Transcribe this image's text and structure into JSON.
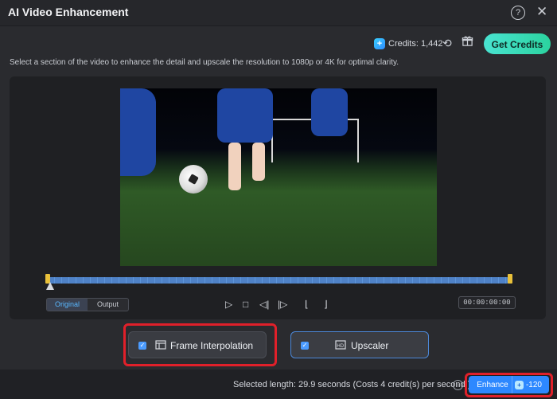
{
  "window": {
    "title": "AI Video Enhancement"
  },
  "toolbar": {
    "credits_label": "Credits: 1,442",
    "get_credits_label": "Get Credits"
  },
  "description": "Select a section of the video to enhance the detail and upscale the resolution to 1080p or 4K for optimal clarity.",
  "preview": {
    "toggle": {
      "original": "Original",
      "output": "Output"
    },
    "timecode": "00:00:00:00"
  },
  "options": {
    "frame_interpolation": "Frame Interpolation",
    "upscaler": "Upscaler"
  },
  "footer": {
    "selected_length": "Selected length: 29.9 seconds (Costs 4 credit(s) per second.)",
    "enhance_label": "Enhance",
    "enhance_cost": "-120"
  }
}
